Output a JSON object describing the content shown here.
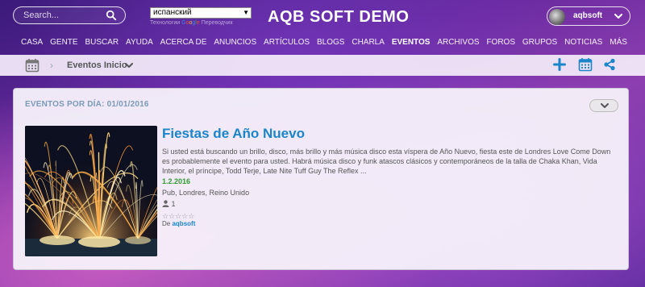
{
  "header": {
    "search_placeholder": "Search...",
    "language": "испанский",
    "translate_prefix": "Технологии",
    "translate_brand": [
      "G",
      "o",
      "o",
      "g",
      "l",
      "e"
    ],
    "translate_suffix": "Переводчик",
    "site_title": "AQB SOFT DEMO",
    "username": "aqbsoft"
  },
  "nav": {
    "items": [
      "CASA",
      "GENTE",
      "BUSCAR",
      "AYUDA",
      "ACERCA DE",
      "ANUNCIOS",
      "ARTÍCULOS",
      "BLOGS",
      "CHARLA",
      "EVENTOS",
      "ARCHIVOS",
      "FOROS",
      "GRUPOS",
      "NOTICIAS",
      "MÁS"
    ],
    "active_index": 9
  },
  "toolbar": {
    "breadcrumb": "Eventos Inicio"
  },
  "panel": {
    "header": "EVENTOS POR DÍA: 01/01/2016",
    "event": {
      "title": "Fiestas de Año Nuevo",
      "description": "Si usted está buscando un brillo, disco, más brillo y más música disco esta víspera de Año Nuevo, fiesta este de Londres Love Come Down es probablemente el evento para usted. Habrá música disco y funk atascos clásicos y contemporáneos de la talla de Chaka Khan, Vida Interior, el príncipe, Todd Terje, Late Nite Tuff Guy The Reflex ...",
      "date": "1.2.2016",
      "location": "Pub, Londres, Reino Unido",
      "participants": "1",
      "rating_stars": "☆☆☆☆☆",
      "author_prefix": "De",
      "author": "aqbsoft"
    }
  },
  "colors": {
    "accent": "#1a85c8",
    "date_green": "#2e9a30",
    "panel_header": "#7a9ab8"
  },
  "icons": [
    "search-icon",
    "chevron-down-icon",
    "calendar-icon",
    "chevron-right-icon",
    "plus-icon",
    "share-icon",
    "user-icon",
    "star-icon"
  ]
}
